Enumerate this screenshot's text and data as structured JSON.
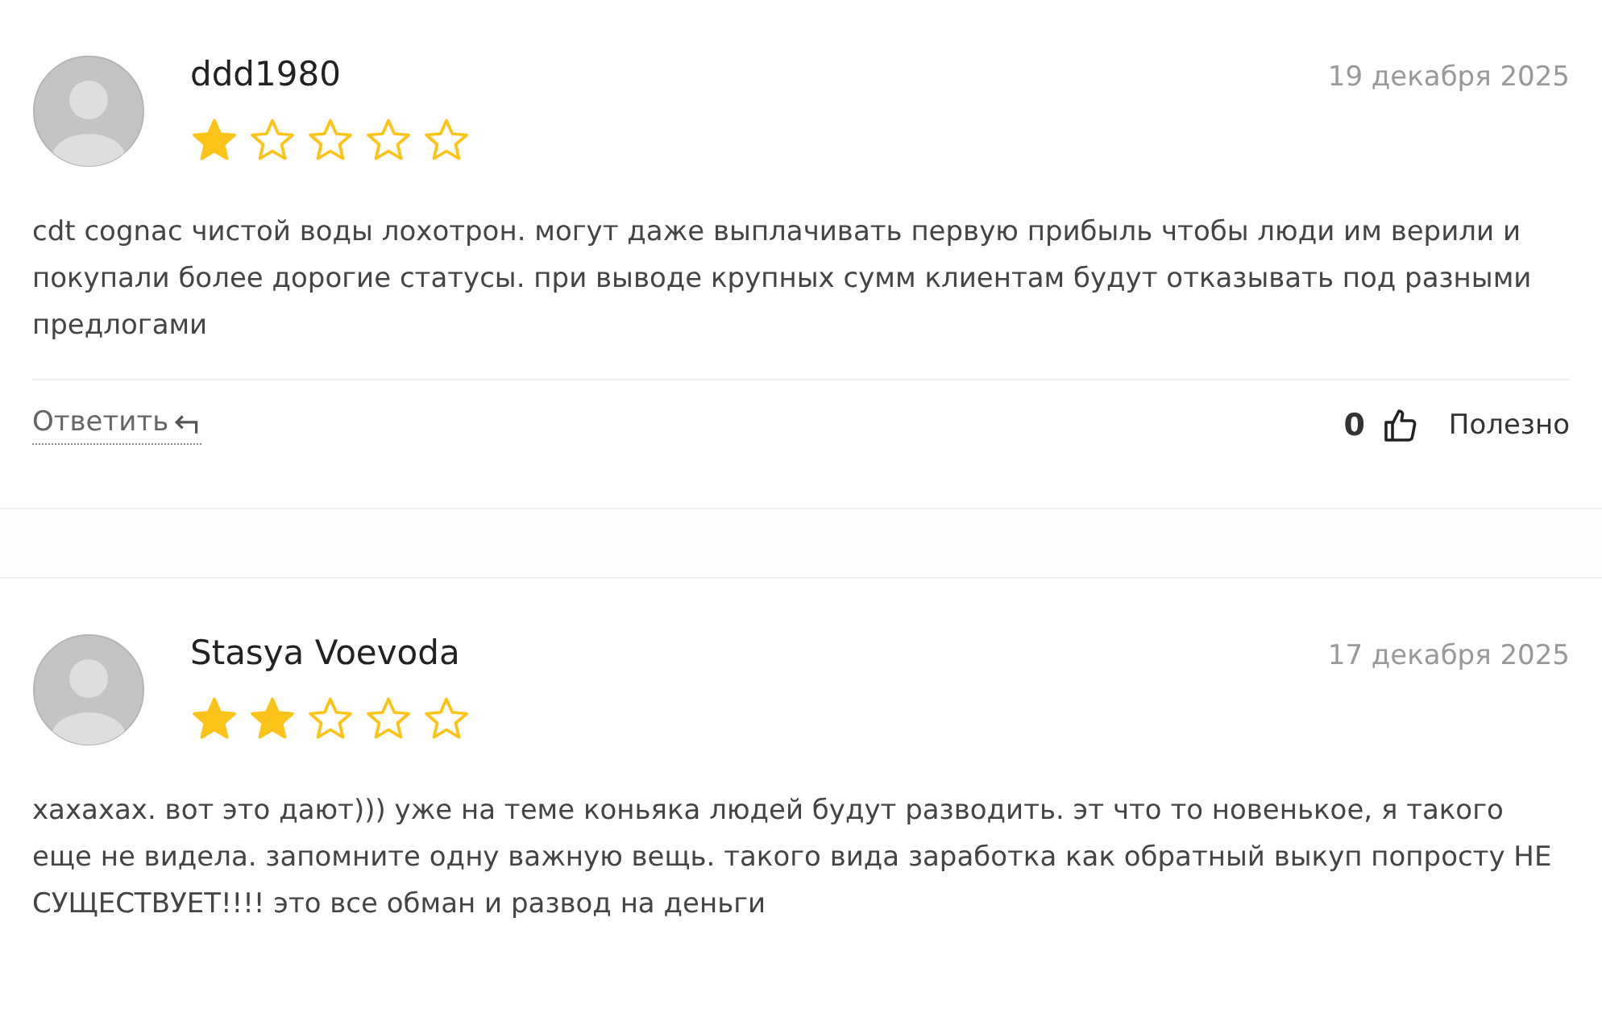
{
  "reviews": [
    {
      "author": "ddd1980",
      "date": "19 декабря 2025",
      "stars": 1,
      "text": "cdt cognac чистой воды лохотрон. могут даже выплачивать первую прибыль чтобы люди им верили и покупали более дорогие статусы. при выводе крупных сумм клиентам будут отказывать под разными предлогами",
      "footer": {
        "reply_label": "Ответить",
        "likes": "0",
        "useful_label": "Полезно"
      }
    },
    {
      "author": "Stasya Voevoda",
      "date": "17 декабря 2025",
      "stars": 2,
      "text": "хахахах. вот это дают))) уже на теме коньяка людей будут разводить. эт что то новенькое, я такого еще не видела. запомните одну важную вещь. такого вида заработка как обратный выкуп попросту НЕ СУЩЕСТВУЕТ!!!! это все обман и развод на деньги"
    }
  ]
}
